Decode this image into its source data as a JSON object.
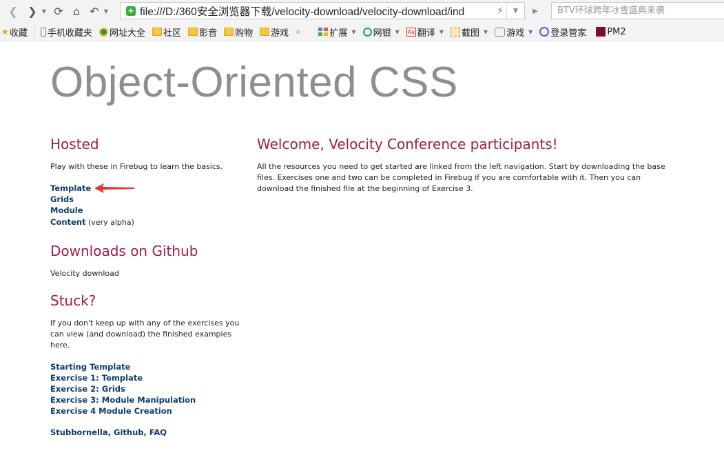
{
  "browser": {
    "address_url": "file:///D:/360安全浏览器下载/velocity-download/velocity-download/ind",
    "search_placeholder": "BTV环球跨年冰雪盛典来袭",
    "bookmarks": [
      {
        "label": "收藏",
        "icon": "star-icon"
      },
      {
        "label": "手机收藏夹",
        "icon": "phone-icon"
      },
      {
        "label": "网址大全",
        "icon": "globe-icon"
      },
      {
        "label": "社区",
        "icon": "folder-icon"
      },
      {
        "label": "影音",
        "icon": "folder-icon"
      },
      {
        "label": "购物",
        "icon": "folder-icon"
      },
      {
        "label": "游戏",
        "icon": "folder-icon"
      },
      {
        "label": "扩展",
        "icon": "grid-icon"
      },
      {
        "label": "网银",
        "icon": "bank-icon"
      },
      {
        "label": "翻译",
        "icon": "translate-icon",
        "icon_text": "Aa"
      },
      {
        "label": "截图",
        "icon": "crop-icon"
      },
      {
        "label": "游戏",
        "icon": "gamepad-icon"
      },
      {
        "label": "登录管家",
        "icon": "key-icon"
      },
      {
        "label": "PM2",
        "icon": "pm-icon"
      }
    ]
  },
  "page": {
    "title": "Object-Oriented CSS",
    "hosted": {
      "heading": "Hosted",
      "intro": "Play with these in Firebug to learn the basics.",
      "links": [
        {
          "label": "Template"
        },
        {
          "label": "Grids"
        },
        {
          "label": "Module"
        },
        {
          "label": "Content",
          "note": " (very alpha)"
        }
      ]
    },
    "downloads": {
      "heading": "Downloads on Github",
      "text": "Velocity download"
    },
    "stuck": {
      "heading": "Stuck?",
      "intro": "If you don't keep up with any of the exercises you can view (and download) the finished examples here.",
      "links": [
        {
          "label": "Starting Template"
        },
        {
          "label": "Exercise 1: Template"
        },
        {
          "label": "Exercise 2: Grids"
        },
        {
          "label": "Exercise 3: Module Manipulation"
        },
        {
          "label": "Exercise 4 Module Creation"
        }
      ],
      "footer_links": [
        {
          "label": "Stubbornella"
        },
        {
          "label": "Github"
        },
        {
          "label": "FAQ"
        }
      ],
      "footer_separator": ", "
    },
    "welcome": {
      "heading": "Welcome, Velocity Conference participants!",
      "body": "All the resources you need to get started are linked from the left navigation. Start by downloading the base files. Exercises one and two can be completed in Firebug if you are comfortable with it. Then you can download the finished file at the beginning of Exercise 3."
    }
  },
  "colors": {
    "heading": "#a31a48",
    "link": "#0e3b6b",
    "hero": "#8e8e8e",
    "annotation_arrow": "#e8352b"
  }
}
